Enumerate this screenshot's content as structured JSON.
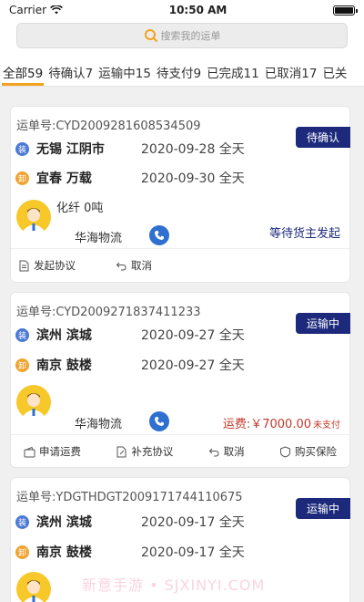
{
  "status_bar": {
    "carrier": "Carrier",
    "time": "10:50 AM"
  },
  "search": {
    "placeholder": "搜索我的运单",
    "icon": "search-icon"
  },
  "tabs": [
    {
      "label": "全部59",
      "active": true
    },
    {
      "label": "待确认7",
      "active": false
    },
    {
      "label": "运输中15",
      "active": false
    },
    {
      "label": "待支付9",
      "active": false
    },
    {
      "label": "已完成11",
      "active": false
    },
    {
      "label": "已取消17",
      "active": false
    },
    {
      "label": "已关",
      "active": false
    }
  ],
  "orders": [
    {
      "order_no": "运单号:CYD2009281608534509",
      "status": "待确认",
      "from": {
        "icon": "装",
        "place": "无锡 江阴市",
        "date": "2020-09-28 全天"
      },
      "to": {
        "icon": "卸",
        "place": "宜春 万载",
        "date": "2020-09-30 全天"
      },
      "cargo": "化纤  0吨",
      "company": "华海物流",
      "note": "等待货主发起",
      "actions": [
        "发起协议",
        "取消"
      ]
    },
    {
      "order_no": "运单号:CYD2009271837411233",
      "status": "运输中",
      "from": {
        "icon": "装",
        "place": "滨州 滨城",
        "date": "2020-09-27 全天"
      },
      "to": {
        "icon": "卸",
        "place": "南京 鼓楼",
        "date": "2020-09-27 全天"
      },
      "company": "华海物流",
      "fee_label": "运费:￥7000.00",
      "fee_status": "未支付",
      "actions": [
        "申请运费",
        "补充协议",
        "取消",
        "购买保险"
      ]
    },
    {
      "order_no": "运单号:YDGTHDGT2009171744110675",
      "status": "运输中",
      "from": {
        "icon": "装",
        "place": "滨州 滨城",
        "date": "2020-09-17 全天"
      },
      "to": {
        "icon": "卸",
        "place": "南京 鼓楼",
        "date": "2020-09-17 全天"
      }
    }
  ],
  "watermark": "新意手游 • SJXINYI.COM",
  "colors": {
    "badge": "#1d2a7c",
    "tab_active": "#f2a321",
    "start": "#4a78d6",
    "end": "#f0a330",
    "fee": "#c0392b"
  }
}
